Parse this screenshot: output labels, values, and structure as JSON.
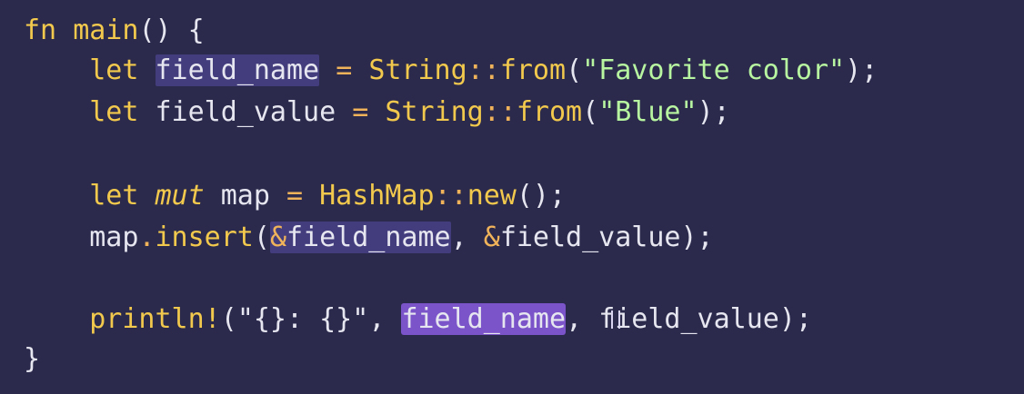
{
  "code": {
    "line1": {
      "kw_fn": "fn",
      "fn_name": "main",
      "rest": "() {"
    },
    "line2": {
      "kw_let": "let",
      "var": "field_name",
      "eq": "=",
      "type": "String",
      "sep": "::",
      "method": "from",
      "open": "(",
      "string": "\"Favorite color\"",
      "close": ");"
    },
    "line3": {
      "kw_let": "let",
      "var": "field_value",
      "eq": "=",
      "type": "String",
      "sep": "::",
      "method": "from",
      "open": "(",
      "string": "\"Blue\"",
      "close": ");"
    },
    "line5": {
      "kw_let": "let",
      "kw_mut": "mut",
      "var": "map",
      "eq": "=",
      "type": "HashMap",
      "sep": "::",
      "method": "new",
      "close": "();"
    },
    "line6": {
      "obj": "map",
      "dot": ".",
      "method": "insert",
      "open": "(",
      "amp1": "&",
      "arg1": "field_name",
      "comma": ", ",
      "amp2": "&",
      "arg2": "field_value",
      "close": ");"
    },
    "line8": {
      "macro": "println!",
      "open": "(",
      "string": "\"{}: {}\"",
      "comma1": ", ",
      "arg1": "field_name",
      "comma2": ", ",
      "arg2": "field_value",
      "close": ");"
    },
    "line9": {
      "brace": "}"
    }
  },
  "colors": {
    "background": "#2b2a4c",
    "keyword": "#f2c94c",
    "string": "#b8f5a0",
    "identifier": "#e6e6f0",
    "highlight": "#433d7e",
    "selection": "#7b54c9"
  }
}
